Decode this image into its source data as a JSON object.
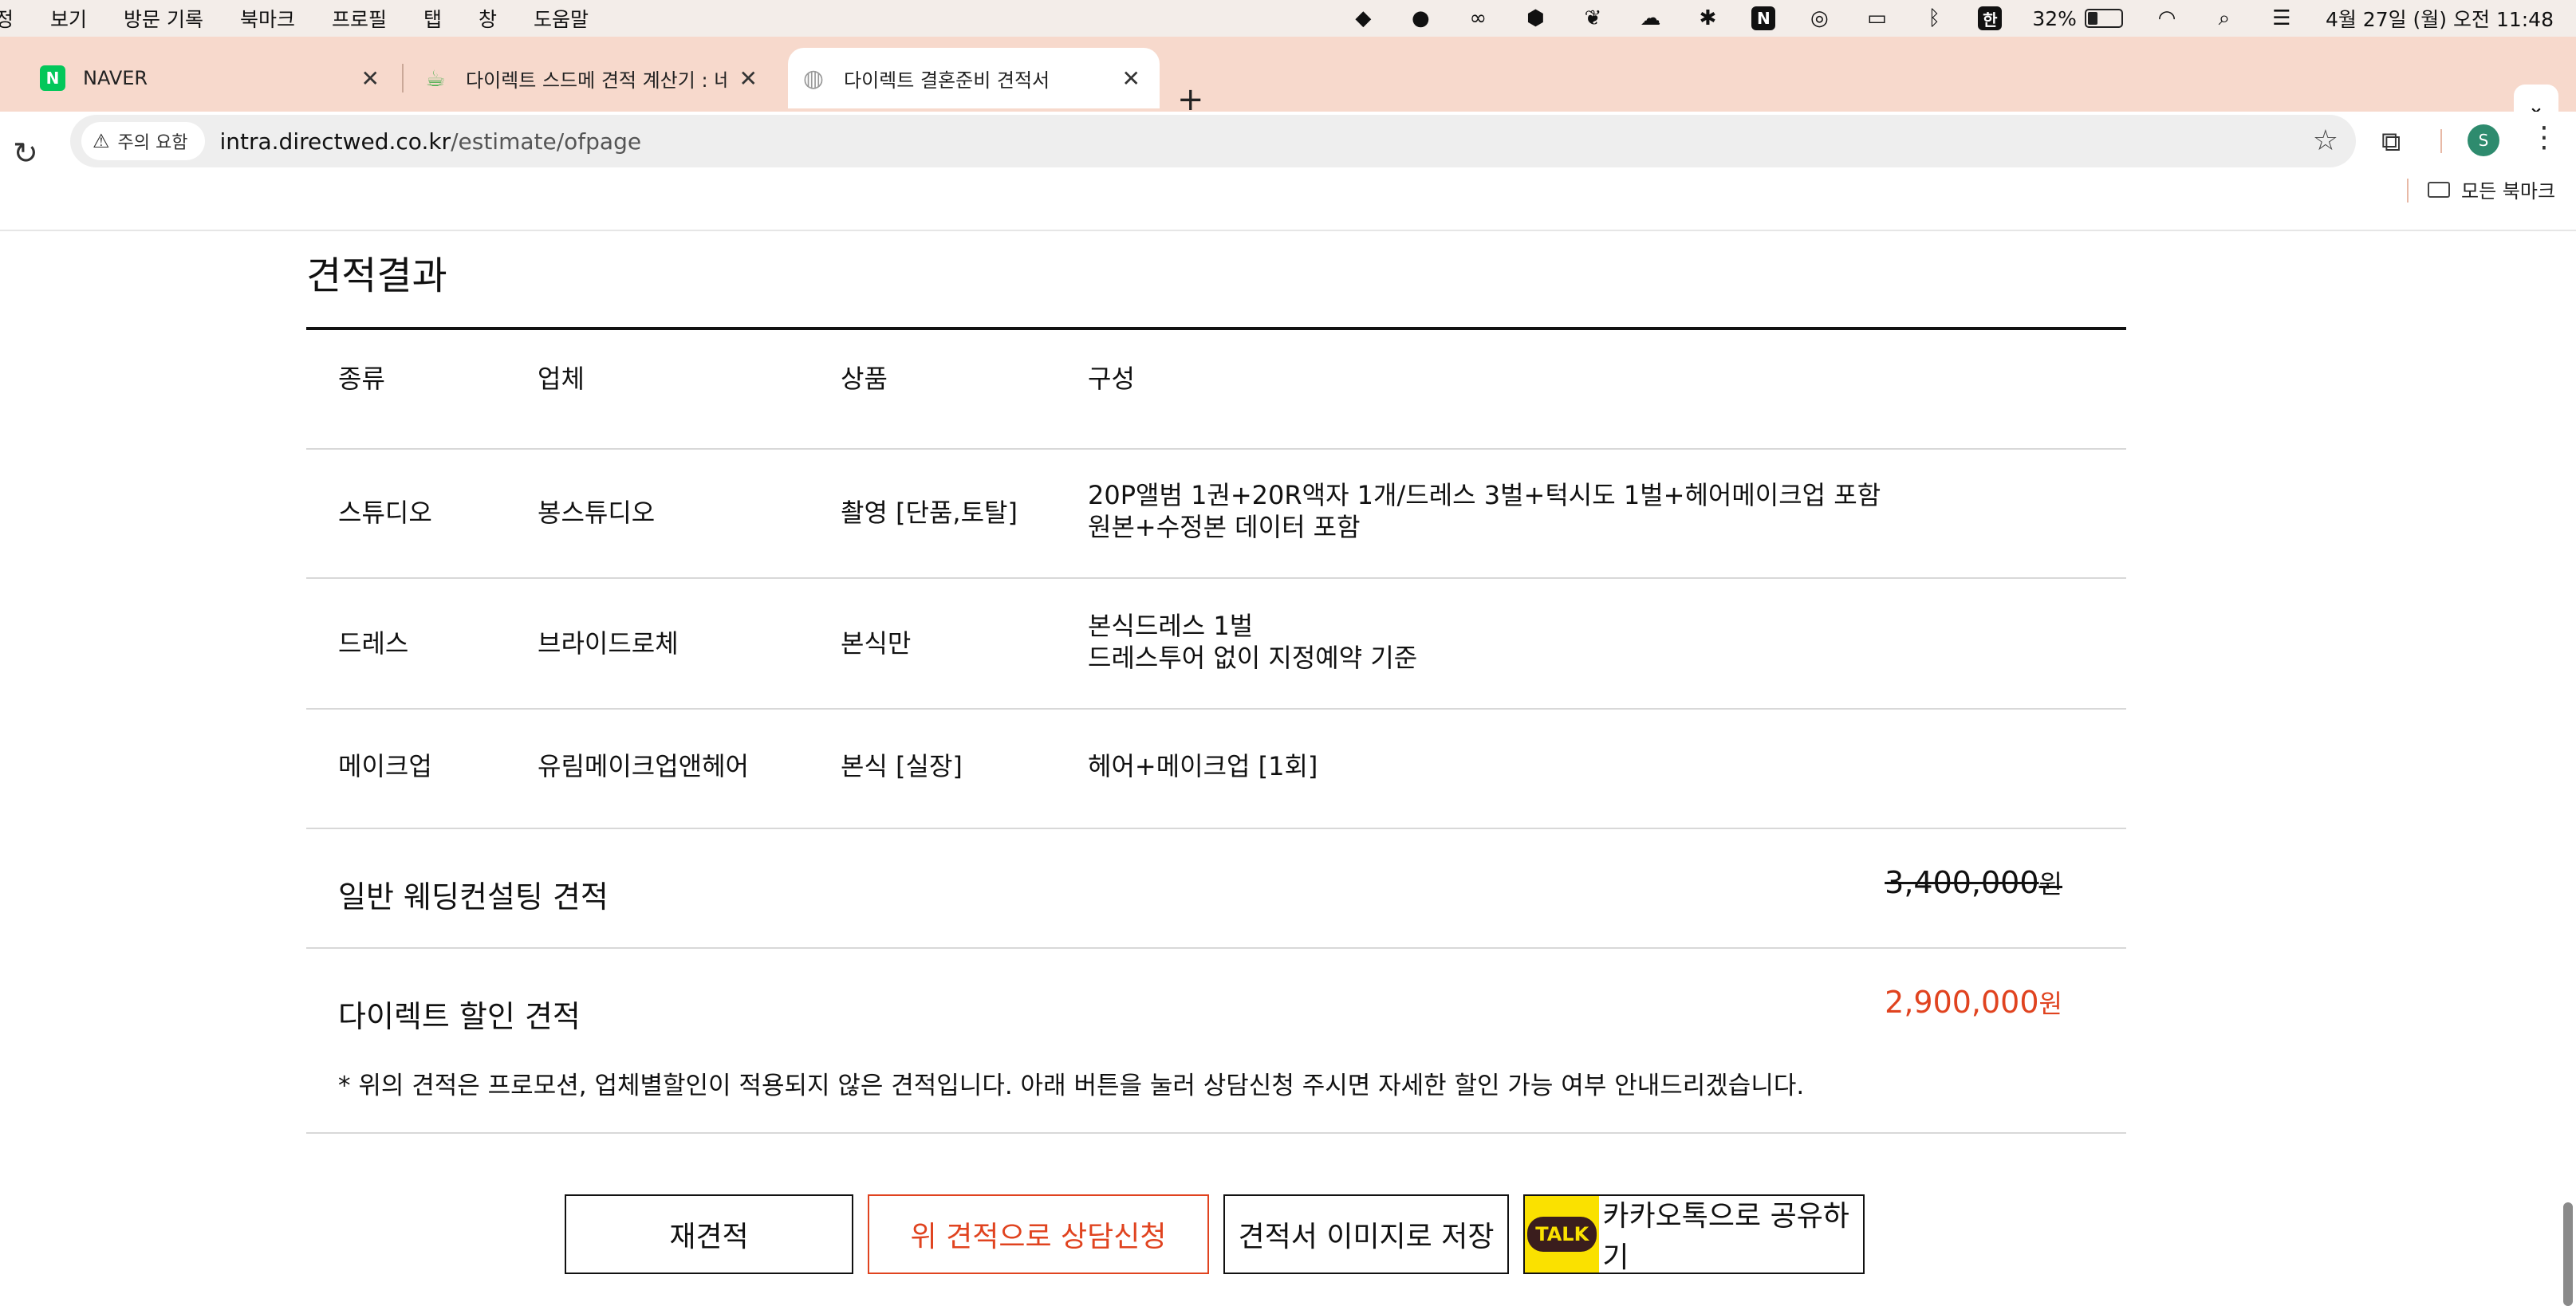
{
  "menubar": {
    "items": [
      "정",
      "보기",
      "방문 기록",
      "북마크",
      "프로필",
      "탭",
      "창",
      "도움말"
    ],
    "battery": "32%",
    "ime": "한",
    "datetime": "4월 27일 (월) 오전 11:48"
  },
  "tabs": [
    {
      "title": "NAVER",
      "favicon": "N",
      "favicon_color": "#03c75a"
    },
    {
      "title": "다이렉트 스드메 견적 계산기 : 네이",
      "favicon": "☕",
      "favicon_color": "#4caf50"
    },
    {
      "title": "다이렉트 결혼준비 견적서",
      "favicon": "◍",
      "favicon_color": "#999999"
    }
  ],
  "toolbar": {
    "security_chip": "주의 요함",
    "url_host": "intra.directwed.co.kr",
    "url_path": "/estimate/ofpage",
    "profile_initial": "S",
    "all_bookmarks": "모든 북마크"
  },
  "estimate": {
    "title": "견적결과",
    "headers": {
      "type": "종류",
      "vendor": "업체",
      "product": "상품",
      "composition": "구성"
    },
    "rows": [
      {
        "type": "스튜디오",
        "vendor": "봉스튜디오",
        "product": "촬영 [단품,토탈]",
        "line1": "20P앨범 1권+20R액자 1개/드레스 3벌+턱시도 1벌+헤어메이크업 포함",
        "line2": "원본+수정본 데이터 포함"
      },
      {
        "type": "드레스",
        "vendor": "브라이드로체",
        "product": "본식만",
        "line1": "본식드레스 1벌",
        "line2": "드레스투어 없이 지정예약 기준"
      },
      {
        "type": "메이크업",
        "vendor": "유림메이크업앤헤어",
        "product": "본식 [실장]",
        "line1": "헤어+메이크업 [1회]",
        "line2": ""
      }
    ],
    "regular_label": "일반 웨딩컨설팅 견적",
    "regular_price": "3,400,000",
    "discount_label": "다이렉트 할인 견적",
    "discount_price": "2,900,000",
    "currency": "원",
    "notice": "* 위의 견적은 프로모션, 업체별할인이 적용되지 않은 견적입니다. 아래 버튼을 눌러 상담신청 주시면 자세한 할인 가능 여부 안내드리겠습니다."
  },
  "buttons": {
    "reestimate": "재견적",
    "consult": "위 견적으로 상담신청",
    "save_image": "견적서 이미지로 저장",
    "kakao_badge": "TALK",
    "kakao_share": "카카오톡으로 공유하기"
  },
  "colors": {
    "accent": "#e0431f",
    "tab_strip": "#f7d9cc",
    "kakao": "#fae100"
  }
}
